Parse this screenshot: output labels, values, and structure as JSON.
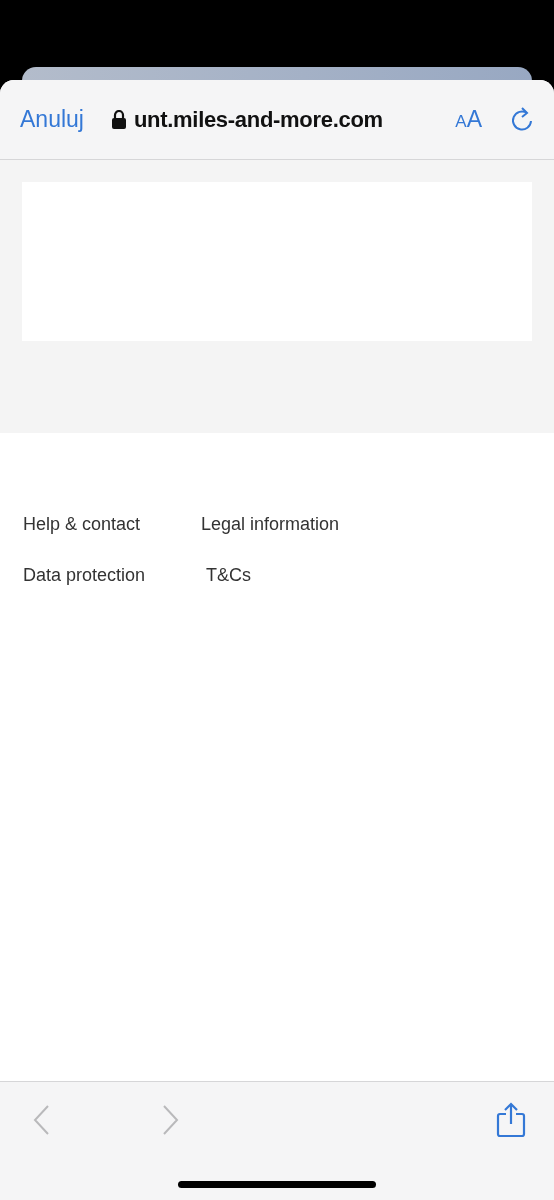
{
  "browser": {
    "cancel": "Anuluj",
    "secure": true,
    "url": "unt.miles-and-more.com",
    "text_size": "AA"
  },
  "footer_links": [
    {
      "label": "Help & contact"
    },
    {
      "label": "Legal information"
    },
    {
      "label": "Data protection"
    },
    {
      "label": "T&Cs"
    }
  ],
  "toolbar": {
    "back_disabled": true,
    "forward_disabled": true
  }
}
